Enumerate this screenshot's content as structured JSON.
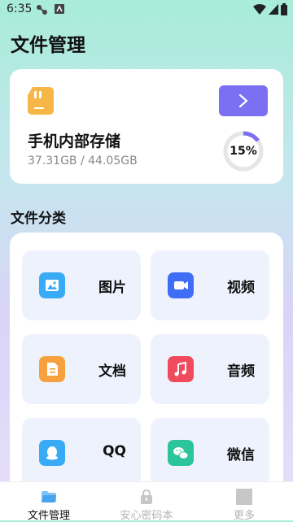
{
  "status_bar": {
    "time": "6:35"
  },
  "page_title": "文件管理",
  "storage": {
    "title": "手机内部存储",
    "used": "37.31GB",
    "total": "44.05GB",
    "size_text": "37.31GB / 44.05GB",
    "percent": 15,
    "percent_label": "15%",
    "button_icon": "chevron-right-icon",
    "accent_color": "#7b70f2"
  },
  "categories": {
    "title": "文件分类",
    "items": [
      {
        "label": "图片",
        "icon": "image-icon",
        "color": "#38aaf6"
      },
      {
        "label": "视频",
        "icon": "video-icon",
        "color": "#3d6ef5"
      },
      {
        "label": "文档",
        "icon": "document-icon",
        "color": "#f7a13e"
      },
      {
        "label": "音频",
        "icon": "music-icon",
        "color": "#ef4b5c"
      },
      {
        "label": "QQ",
        "icon": "qq-icon",
        "color": "#38aaf6"
      },
      {
        "label": "微信",
        "icon": "wechat-icon",
        "color": "#2cc49a"
      }
    ]
  },
  "bottom_nav": {
    "items": [
      {
        "label": "文件管理",
        "icon": "folder-icon",
        "active": true,
        "color": "#111111"
      },
      {
        "label": "安心密码本",
        "icon": "lock-icon",
        "active": false,
        "color": "#b3b3b3"
      },
      {
        "label": "更多",
        "icon": "more-icon",
        "active": false,
        "color": "#b3b3b3"
      }
    ]
  }
}
